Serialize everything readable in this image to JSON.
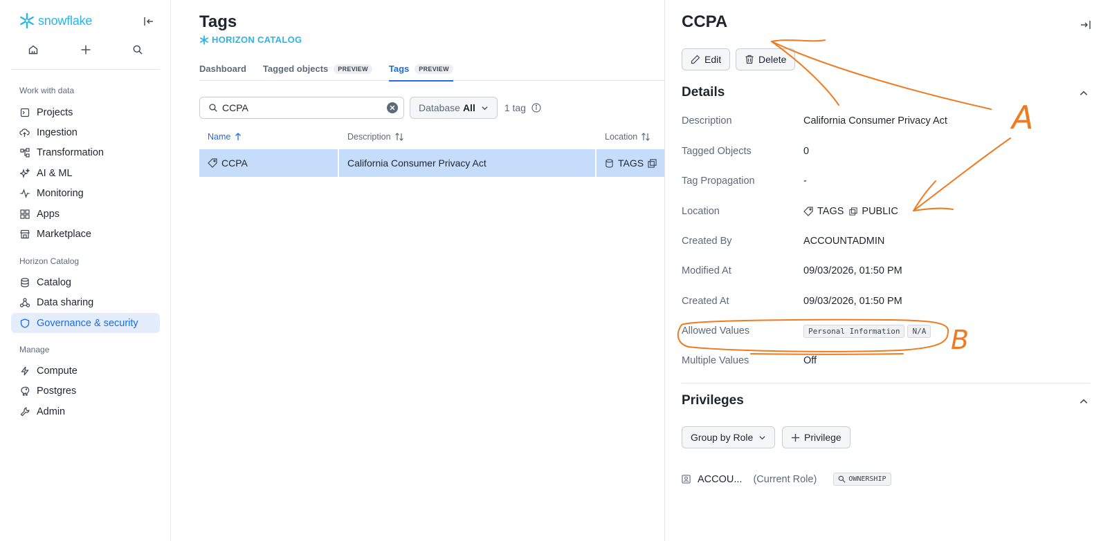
{
  "app": {
    "logo_text": "snowflake"
  },
  "sidebar": {
    "sections": [
      {
        "label": "Work with data"
      },
      {
        "label": "Horizon Catalog"
      },
      {
        "label": "Manage"
      }
    ],
    "items": [
      {
        "label": "Projects",
        "icon": "projects-icon"
      },
      {
        "label": "Ingestion",
        "icon": "cloud-upload-icon"
      },
      {
        "label": "Transformation",
        "icon": "flow-icon"
      },
      {
        "label": "AI & ML",
        "icon": "sparkle-icon"
      },
      {
        "label": "Monitoring",
        "icon": "pulse-icon"
      },
      {
        "label": "Apps",
        "icon": "grid-icon"
      },
      {
        "label": "Marketplace",
        "icon": "store-icon"
      },
      {
        "label": "Catalog",
        "icon": "database-icon"
      },
      {
        "label": "Data sharing",
        "icon": "share-icon"
      },
      {
        "label": "Governance & security",
        "icon": "shield-icon",
        "active": true
      },
      {
        "label": "Compute",
        "icon": "bolt-icon"
      },
      {
        "label": "Postgres",
        "icon": "elephant-icon"
      },
      {
        "label": "Admin",
        "icon": "wrench-icon"
      }
    ]
  },
  "main": {
    "title": "Tags",
    "catalog_label": "HORIZON CATALOG",
    "tabs": [
      {
        "label": "Dashboard",
        "badge": ""
      },
      {
        "label": "Tagged objects",
        "badge": "PREVIEW"
      },
      {
        "label": "Tags",
        "badge": "PREVIEW",
        "active": true
      }
    ],
    "search": {
      "value": "CCPA",
      "placeholder": "Search"
    },
    "db_filter": {
      "label": "Database",
      "value": "All"
    },
    "count_text": "1 tag",
    "table": {
      "headers": [
        "Name",
        "Description",
        "Location"
      ],
      "rows": [
        {
          "name": "CCPA",
          "description": "California Consumer Privacy Act",
          "location": "TAGS"
        }
      ]
    }
  },
  "panel": {
    "title": "CCPA",
    "edit_label": "Edit",
    "delete_label": "Delete",
    "details_heading": "Details",
    "details": [
      {
        "label": "Description",
        "value": "California Consumer Privacy Act"
      },
      {
        "label": "Tagged Objects",
        "value": "0"
      },
      {
        "label": "Tag Propagation",
        "value": "-"
      },
      {
        "label": "Location",
        "value": "TAGS",
        "value2": "PUBLIC"
      },
      {
        "label": "Created By",
        "value": "ACCOUNTADMIN"
      },
      {
        "label": "Modified At",
        "value": "09/03/2026, 01:50 PM"
      },
      {
        "label": "Created At",
        "value": "09/03/2026, 01:50 PM"
      },
      {
        "label": "Allowed Values",
        "chips": [
          "Personal Information",
          "N/A"
        ]
      },
      {
        "label": "Multiple Values",
        "value": "Off"
      }
    ],
    "privileges_heading": "Privileges",
    "group_by_label": "Group by Role",
    "add_privilege_label": "Privilege",
    "privilege_row": {
      "role": "ACCOU...",
      "role_note": "(Current Role)",
      "privilege": "OWNERSHIP"
    }
  },
  "annotations": {
    "color": "#f07a1e",
    "label_a": "A",
    "label_b": "B"
  },
  "colors": {
    "accent": "#1a6ce7",
    "brand": "#29b5e8",
    "selected_row": "#c6dcfb",
    "active_nav_bg": "#e3edfc"
  }
}
